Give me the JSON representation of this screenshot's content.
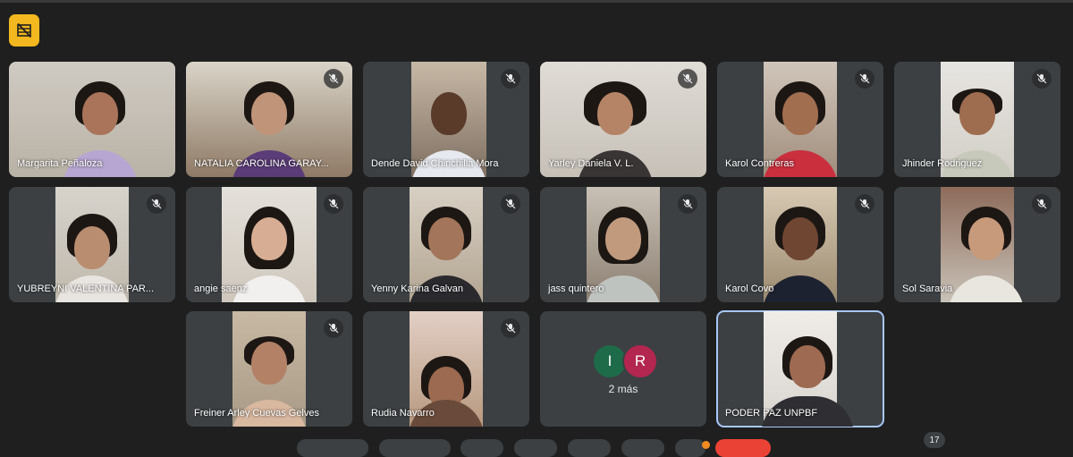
{
  "participants": [
    {
      "name": "Margarita Peñaloza"
    },
    {
      "name": "NATALIA CAROLINA GARAY..."
    },
    {
      "name": "Dende David Chinchilla Mora"
    },
    {
      "name": "Yarley Daniela V. L."
    },
    {
      "name": "Karol Contreras"
    },
    {
      "name": "Jhinder Rodriguez"
    },
    {
      "name": "YUBREYNI VALENTINA PAR..."
    },
    {
      "name": "angie saenz"
    },
    {
      "name": "Yenny Karina Galvan"
    },
    {
      "name": "jass quintero"
    },
    {
      "name": "Karol Covo"
    },
    {
      "name": "Sol Saravia"
    },
    {
      "name": "Freiner Arley Cuevas Gelves"
    },
    {
      "name": "Rudia Navarro"
    }
  ],
  "overflow": {
    "avatars": [
      {
        "initial": "I",
        "color": "#1e6b4a"
      },
      {
        "initial": "R",
        "color": "#b3264f"
      }
    ],
    "label": "2 más"
  },
  "self_tile": {
    "name": "PODER PAZ UNPBF"
  },
  "people_count": "17",
  "colors": {
    "background": "#1f1f1f",
    "tile": "#3c4043",
    "accent_layout": "#f3b81f",
    "active_border": "#a8c7fa",
    "end_call": "#ea4335"
  },
  "icons": [
    "layout-grid-off-icon",
    "mic-off-icon"
  ]
}
